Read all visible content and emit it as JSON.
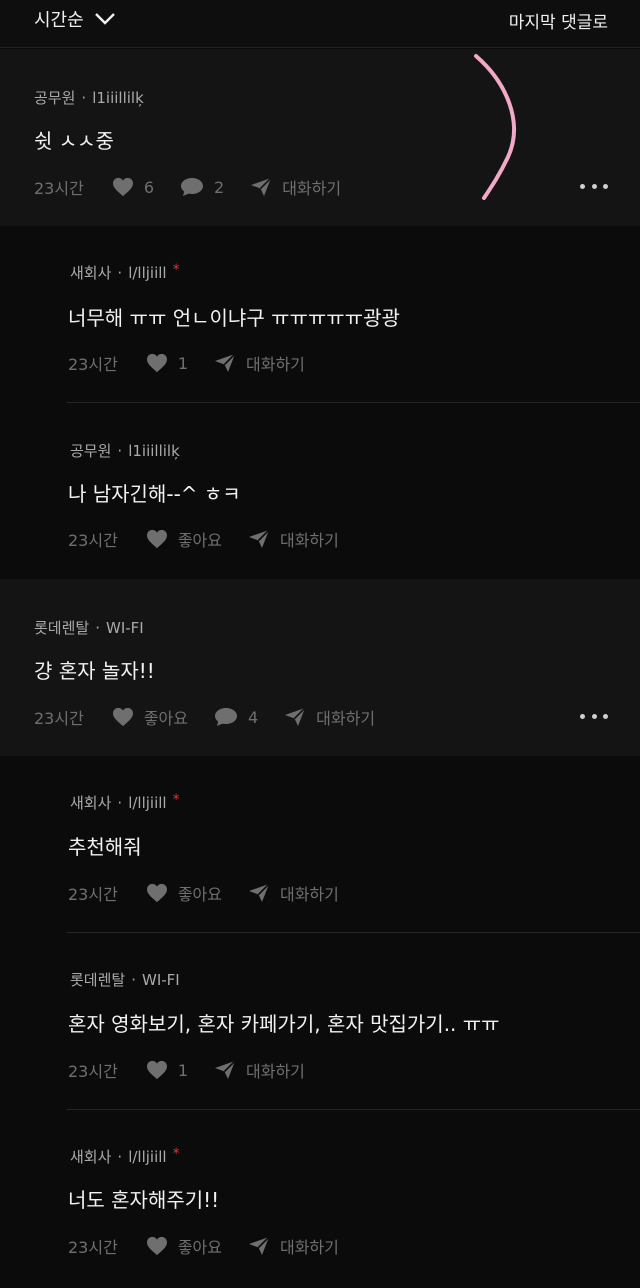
{
  "header": {
    "sort_label": "시간순",
    "last_comment_label": "마지막 댓글로"
  },
  "comments": [
    {
      "level": "top",
      "company": "공무원",
      "nickname": "l1iiillilķ",
      "text": "쉿 ㅅㅅ중",
      "time": "23시간",
      "like": "6",
      "reply": "2",
      "talk": "대화하기"
    },
    {
      "level": "reply",
      "company": "새회사",
      "nickname": "l/lljiill",
      "marker": "*",
      "text": "너무해 ㅠㅠ 언ㄴ이냐구 ㅠㅠㅠㅠㅠ광광",
      "time": "23시간",
      "like": "1",
      "talk": "대화하기"
    },
    {
      "level": "reply",
      "company": "공무원",
      "nickname": "l1iiillilķ",
      "text": "나 남자긴해--^ ㅎㅋ",
      "time": "23시간",
      "like": "좋아요",
      "talk": "대화하기"
    },
    {
      "level": "top",
      "company": "롯데렌탈",
      "nickname": "WI-FI",
      "text": "걍 혼자 놀자!!",
      "time": "23시간",
      "like": "좋아요",
      "reply": "4",
      "talk": "대화하기"
    },
    {
      "level": "reply",
      "company": "새회사",
      "nickname": "l/lljiill",
      "marker": "*",
      "text": "추천해줘",
      "time": "23시간",
      "like": "좋아요",
      "talk": "대화하기"
    },
    {
      "level": "reply",
      "company": "롯데렌탈",
      "nickname": "WI-FI",
      "text": "혼자 영화보기, 혼자 카페가기, 혼자 맛집가기.. ㅠㅠ",
      "time": "23시간",
      "like": "1",
      "talk": "대화하기"
    },
    {
      "level": "reply",
      "company": "새회사",
      "nickname": "l/lljiill",
      "marker": "*",
      "text": "너도 혼자해주기!!",
      "time": "23시간",
      "like": "좋아요",
      "talk": "대화하기"
    }
  ],
  "colors": {
    "background": "#0b0b0c",
    "top_comment_bg": "#141415",
    "marker": "#e0342f",
    "pen_stroke": "#f2a9c8"
  }
}
